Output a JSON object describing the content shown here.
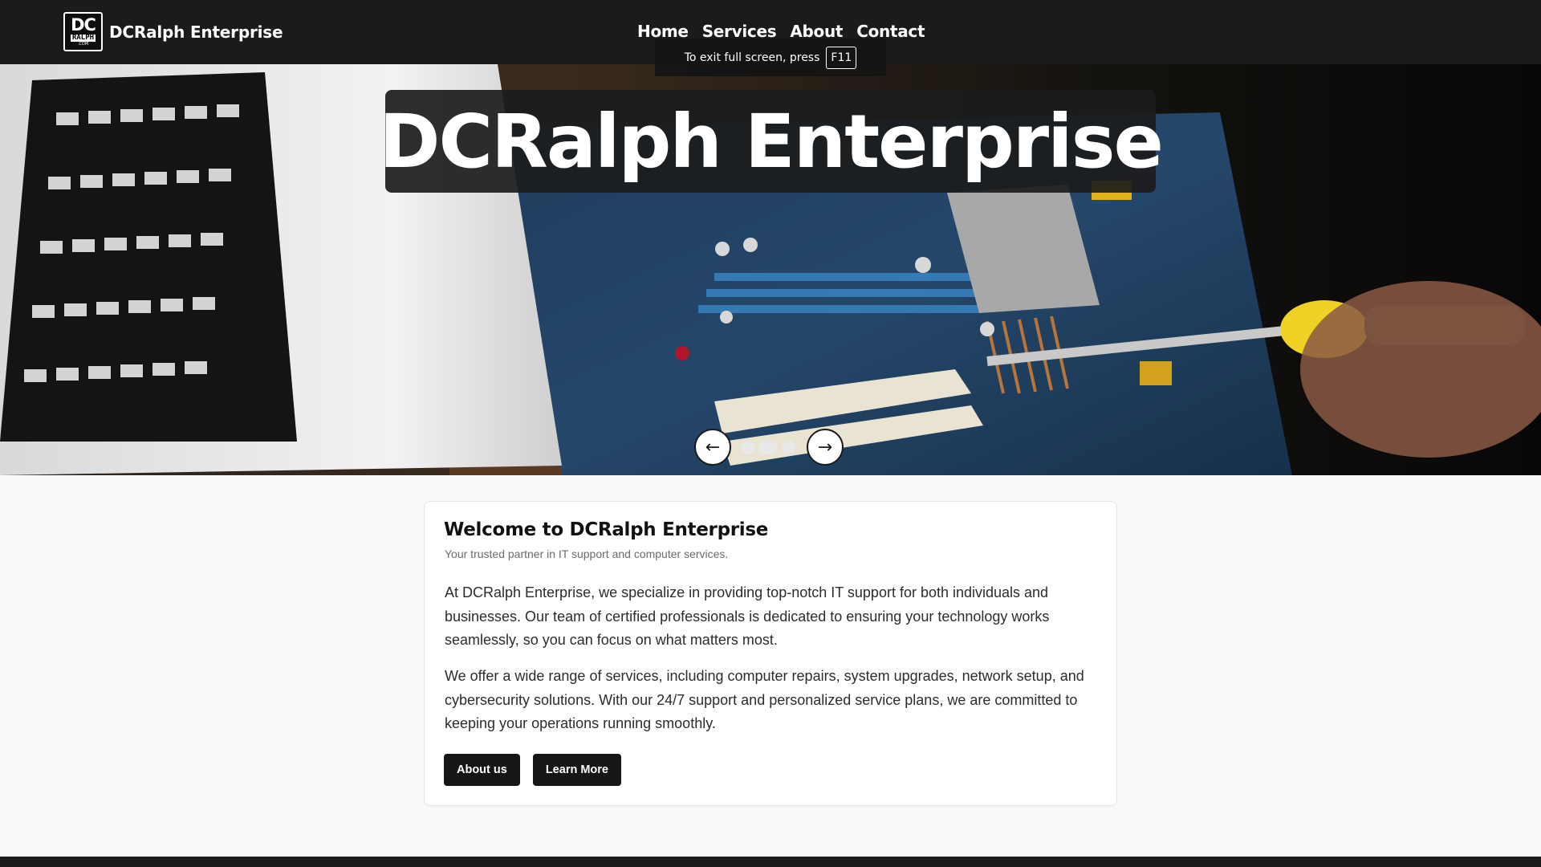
{
  "header": {
    "logo_line1": "DC",
    "logo_line2": "RALPH",
    "logo_line3": ".COM",
    "brand": "DCRalph Enterprise",
    "nav": [
      "Home",
      "Services",
      "About",
      "Contact"
    ]
  },
  "fullscreen_toast": {
    "text": "To exit full screen, press",
    "key": "F11"
  },
  "hero": {
    "title": "DCRalph Enterprise",
    "prev_icon": "arrow-left-icon",
    "next_icon": "arrow-right-icon",
    "slide_count": 3,
    "active_slide": 2
  },
  "welcome": {
    "title": "Welcome to DCRalph Enterprise",
    "subtitle": "Your trusted partner in IT support and computer services.",
    "paragraph1": "At DCRalph Enterprise, we specialize in providing top-notch IT support for both individuals and businesses. Our team of certified professionals is dedicated to ensuring your technology works seamlessly, so you can focus on what matters most.",
    "paragraph2": "We offer a wide range of services, including computer repairs, system upgrades, network setup, and cybersecurity solutions. With our 24/7 support and personalized service plans, we are committed to keeping your operations running smoothly.",
    "buttons": [
      "About us",
      "Learn More"
    ]
  },
  "colors": {
    "nav_bg": "#1b1b1b",
    "page_bg": "#f8f9fb",
    "button_bg": "#161616"
  }
}
